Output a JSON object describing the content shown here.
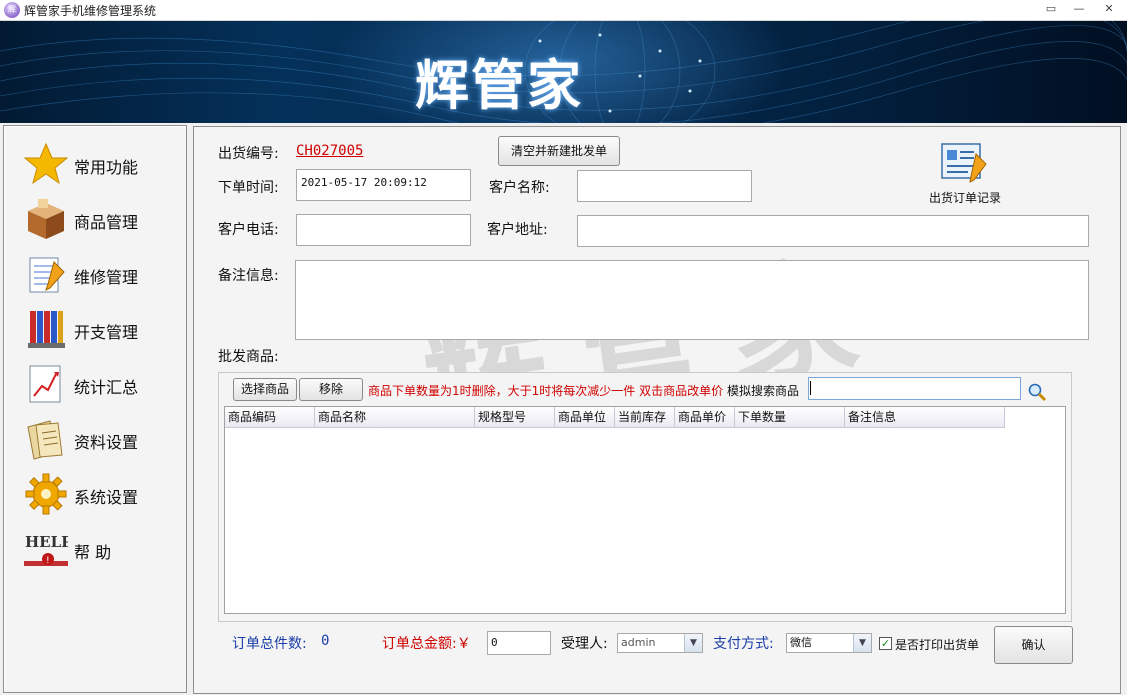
{
  "window": {
    "title": "辉管家手机维修管理系统",
    "app_icon_text": "辉",
    "controls": {
      "restore": "▭",
      "minimize": "—",
      "close": "✕"
    }
  },
  "banner": {
    "title": "辉管家"
  },
  "sidebar": {
    "items": [
      {
        "label": "常用功能",
        "icon": "star-icon"
      },
      {
        "label": "商品管理",
        "icon": "box-icon"
      },
      {
        "label": "维修管理",
        "icon": "notepad-icon"
      },
      {
        "label": "开支管理",
        "icon": "books-icon"
      },
      {
        "label": "统计汇总",
        "icon": "chart-icon"
      },
      {
        "label": "资料设置",
        "icon": "folder-icon"
      },
      {
        "label": "系统设置",
        "icon": "gear-icon"
      },
      {
        "label": "帮  助",
        "icon": "help-icon"
      }
    ]
  },
  "form": {
    "order_no_label": "出货编号:",
    "order_no_value": "CH027005",
    "clear_button": "清空并新建批发单",
    "order_time_label": "下单时间:",
    "order_time_value": "2021-05-17 20:09:12",
    "customer_name_label": "客户名称:",
    "customer_name_value": "",
    "customer_phone_label": "客户电话:",
    "customer_phone_value": "",
    "customer_address_label": "客户地址:",
    "customer_address_value": "",
    "remark_label": "备注信息:",
    "remark_value": "",
    "records_label": "出货订单记录"
  },
  "watermark": "辉管家",
  "goods": {
    "section_label": "批发商品:",
    "select_button": "选择商品",
    "remove_button": "移除",
    "hint": "商品下单数量为1时删除，大于1时将每次减少一件  双击商品改单价",
    "search_label": "模拟搜索商品",
    "search_value": "",
    "columns": [
      "商品编码",
      "商品名称",
      "规格型号",
      "商品单位",
      "当前库存",
      "商品单价",
      "下单数量",
      "备注信息"
    ],
    "rows": []
  },
  "footer": {
    "total_count_label": "订单总件数:",
    "total_count_value": "0",
    "total_amount_label": "订单总金额:￥",
    "total_amount_value": "0",
    "handler_label": "受理人:",
    "handler_value": "admin",
    "payment_label": "支付方式:",
    "payment_value": "微信",
    "print_label": "是否打印出货单",
    "print_checked": true,
    "confirm_button": "确认"
  },
  "colors": {
    "banner_bg": "#04315a",
    "order_no": "#d00000",
    "hint": "#d00000",
    "footer_blue": "#1b3ea8"
  }
}
